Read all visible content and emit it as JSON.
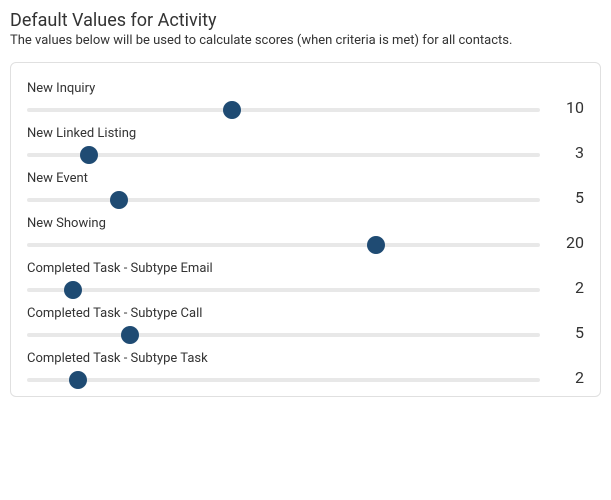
{
  "header": {
    "title": "Default Values for Activity",
    "subtitle": "The values below will be used to calculate scores (when criteria is met) for all contacts."
  },
  "sliders": [
    {
      "label": "New Inquiry",
      "value": 10,
      "position_pct": 40
    },
    {
      "label": "New Linked Listing",
      "value": 3,
      "position_pct": 12
    },
    {
      "label": "New Event",
      "value": 5,
      "position_pct": 18
    },
    {
      "label": "New Showing",
      "value": 20,
      "position_pct": 68
    },
    {
      "label": "Completed Task - Subtype Email",
      "value": 2,
      "position_pct": 9
    },
    {
      "label": "Completed Task - Subtype Call",
      "value": 5,
      "position_pct": 20
    },
    {
      "label": "Completed Task - Subtype Task",
      "value": 2,
      "position_pct": 10
    }
  ]
}
